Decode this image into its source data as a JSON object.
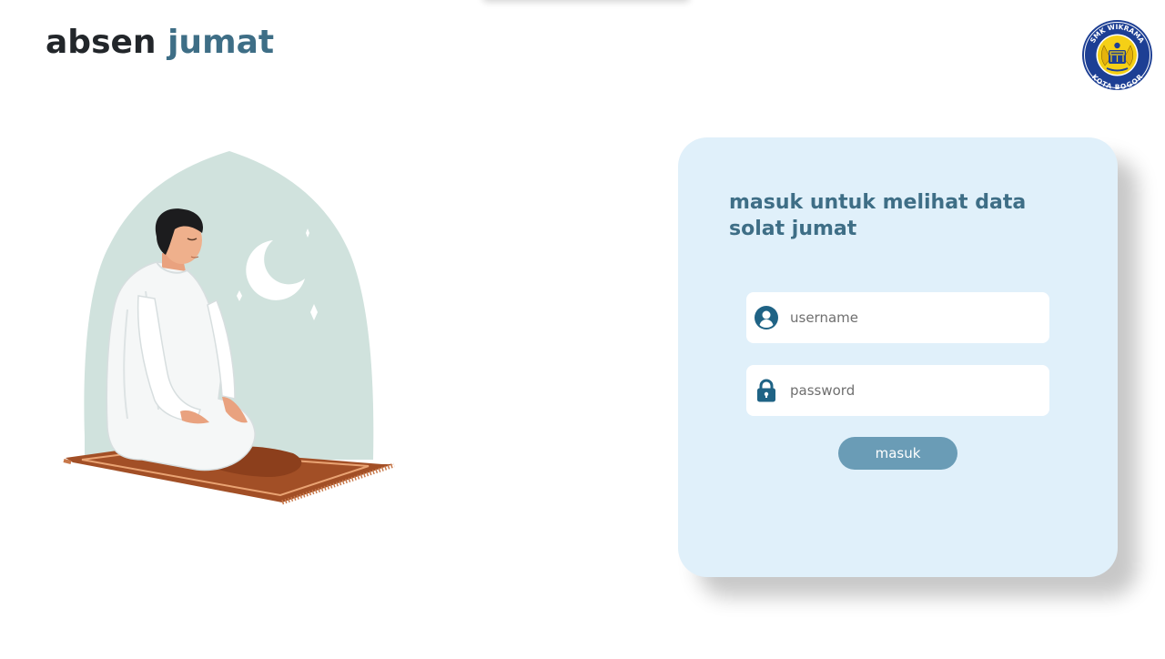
{
  "brand": {
    "word1": "absen",
    "word2": "jumat"
  },
  "logo": {
    "ring_text_top": "SMK WIKRAMA",
    "ring_text_bottom": "KOTA BOGOR"
  },
  "login": {
    "title": "masuk untuk melihat data solat jumat",
    "username_placeholder": "username",
    "password_placeholder": "password",
    "submit_label": "masuk",
    "username_icon": "user-circle-icon",
    "password_icon": "lock-icon"
  },
  "colors": {
    "accent": "#3e6e86",
    "card_bg": "#e0f0fa",
    "button_bg": "#6a9cb6",
    "icon": "#1f6385"
  }
}
